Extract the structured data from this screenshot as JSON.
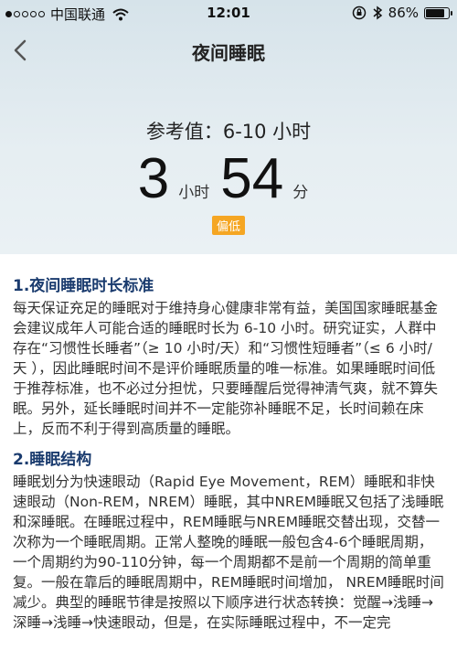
{
  "status_bar": {
    "carrier": "中国联通",
    "time": "12:01",
    "battery": "86%",
    "battery_level": 0.86
  },
  "nav": {
    "title": "夜间睡眠"
  },
  "summary": {
    "reference": "参考值：6-10 小时",
    "hours": "3",
    "hours_unit": "小时",
    "minutes": "54",
    "minutes_unit": "分",
    "badge": "偏低"
  },
  "sections": [
    {
      "title": "1.夜间睡眠时长标准",
      "body": "每天保证充足的睡眠对于维持身心健康非常有益，美国国家睡眠基金会建议成年人可能合适的睡眠时长为 6-10 小时。研究证实，人群中存在“习惯性长睡者”（≥ 10 小时/天）和“习惯性短睡者”（≤ 6 小时/天 ），因此睡眠时间不是评价睡眠质量的唯一标准。如果睡眠时间低于推荐标准，也不必过分担忧，只要睡醒后觉得神清气爽，就不算失眠。另外，延长睡眠时间并不一定能弥补睡眠不足，长时间赖在床上，反而不利于得到高质量的睡眠。"
    },
    {
      "title": "2.睡眠结构",
      "body": "睡眠划分为快速眼动（Rapid Eye Movement，REM）睡眠和非快速眼动（Non-REM，NREM）睡眠，其中NREM睡眠又包括了浅睡眠和深睡眠。在睡眠过程中，REM睡眠与NREM睡眠交替出现，交替一次称为一个睡眠周期。正常人整晚的睡眠一般包含4-6个睡眠周期，一个周期约为90-110分钟，每一个周期都不是前一个周期的简单重复。一般在靠后的睡眠周期中，REM睡眠时间增加， NREM睡眠时间减少。典型的睡眠节律是按照以下顺序进行状态转换：觉醒→浅睡→深睡→浅睡→快速眼动，但是，在实际睡眠过程中，不一定完"
    }
  ]
}
